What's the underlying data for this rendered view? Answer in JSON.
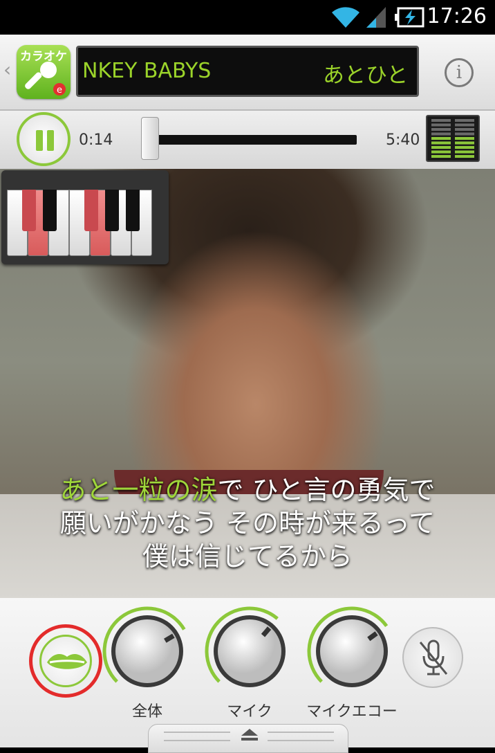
{
  "status_bar": {
    "time": "17:26",
    "icons": [
      "wifi-icon",
      "signal-icon",
      "battery-charging-icon"
    ]
  },
  "header": {
    "app_logo_text": "カラオケ",
    "ticker_artist": "NKEY BABYS",
    "ticker_song": "あとひと",
    "info_symbol": "i"
  },
  "playback": {
    "current_time": "0:14",
    "total_time": "5:40",
    "progress": 0.04
  },
  "lyrics": {
    "line1_sung": "あと一粒の涙",
    "line1_rest": "で ひと言の勇気で",
    "line2": "願いがかなう その時が来るって",
    "line3": "僕は信じてるから"
  },
  "piano": {
    "highlighted_keys": [
      "white-2",
      "white-5",
      "white-6"
    ]
  },
  "controls": {
    "knobs": [
      {
        "label": "全体",
        "level": 0.72
      },
      {
        "label": "マイク",
        "level": 0.65
      },
      {
        "label": "マイクエコー",
        "level": 0.7
      }
    ],
    "mic_muted": true
  },
  "colors": {
    "accent_green": "#8cc83a",
    "lyric_highlight": "#9fd63a",
    "selected_ring": "#e32b2b"
  }
}
